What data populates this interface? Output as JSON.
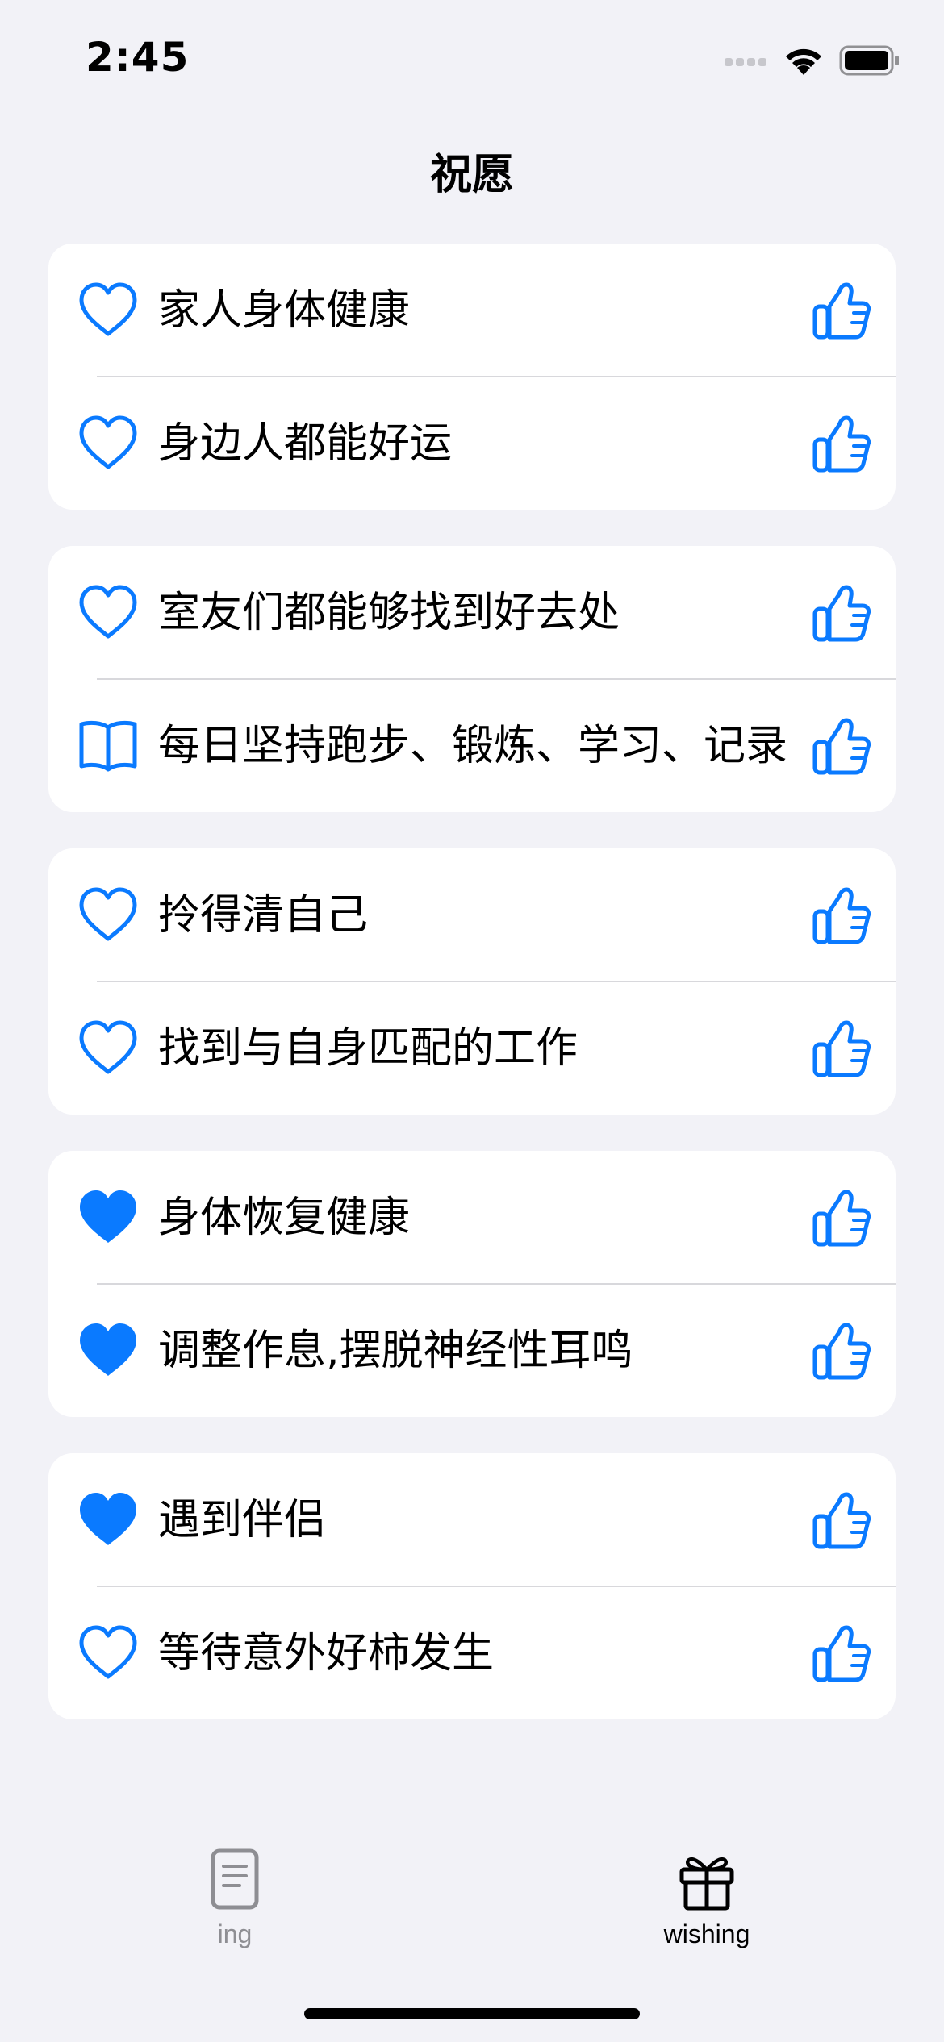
{
  "status_bar": {
    "time": "2:45"
  },
  "title": "祝愿",
  "colors": {
    "accent": "#0a7aff",
    "background": "#f2f2f7",
    "card": "#ffffff",
    "tab_inactive": "#8e8e93",
    "tab_active": "#000000"
  },
  "groups": [
    {
      "items": [
        {
          "label": "家人身体健康",
          "icon": "heart-outline-icon"
        },
        {
          "label": "身边人都能好运",
          "icon": "heart-outline-icon"
        }
      ]
    },
    {
      "items": [
        {
          "label": "室友们都能够找到好去处",
          "icon": "heart-outline-icon"
        },
        {
          "label": "每日坚持跑步、锻炼、学习、记录",
          "icon": "book-icon"
        }
      ]
    },
    {
      "items": [
        {
          "label": "拎得清自己",
          "icon": "heart-outline-icon"
        },
        {
          "label": "找到与自身匹配的工作",
          "icon": "heart-outline-icon"
        }
      ]
    },
    {
      "items": [
        {
          "label": "身体恢复健康",
          "icon": "heart-filled-icon"
        },
        {
          "label": "调整作息,摆脱神经性耳鸣",
          "icon": "heart-filled-icon"
        }
      ]
    },
    {
      "items": [
        {
          "label": "遇到伴侣",
          "icon": "heart-filled-icon"
        },
        {
          "label": "等待意外好柿发生",
          "icon": "heart-outline-icon"
        }
      ]
    }
  ],
  "tabs": [
    {
      "label": "ing",
      "icon": "document-icon",
      "selected": false
    },
    {
      "label": "wishing",
      "icon": "gift-icon",
      "selected": true
    }
  ]
}
